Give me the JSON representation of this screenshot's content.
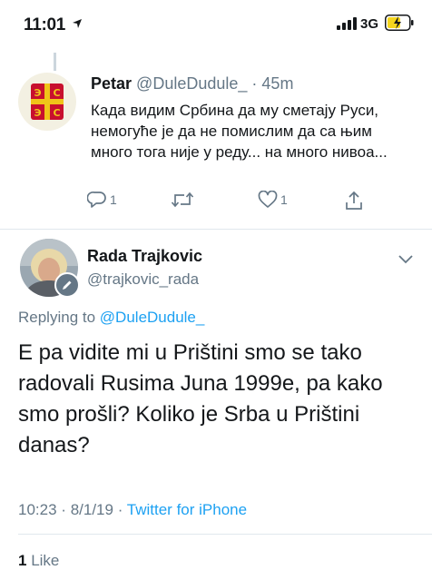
{
  "status_bar": {
    "time": "11:01",
    "network": "3G"
  },
  "parent_tweet": {
    "name": "Petar",
    "handle": "@DuleDudule_",
    "separator": "·",
    "time": "45m",
    "text": "Када видим Србина да му сметају Руси, немогуће је да не помислим да са њим много тога није у реду... на много нивоа...",
    "reply_count": "1",
    "like_count": "1",
    "icons": [
      "reply-icon",
      "retweet-icon",
      "like-icon",
      "share-icon"
    ]
  },
  "main_tweet": {
    "name": "Rada Trajkovic",
    "handle": "@trajkovic_rada",
    "replying_prefix": "Replying to",
    "replying_to": "@DuleDudule_",
    "text": "E pa vidite mi u Prištini smo se tako radovali Rusima Juna 1999e, pa kako smo prošli? Koliko je Srba u Prištini danas?",
    "time": "10:23",
    "date": "8/1/19",
    "separator": "·",
    "source": "Twitter for iPhone",
    "likes_count": "1",
    "likes_label": "Like"
  },
  "colors": {
    "accent": "#1da1f2",
    "secondary": "#657786",
    "divider": "#e1e8ed",
    "battery": "#f5d51e"
  }
}
